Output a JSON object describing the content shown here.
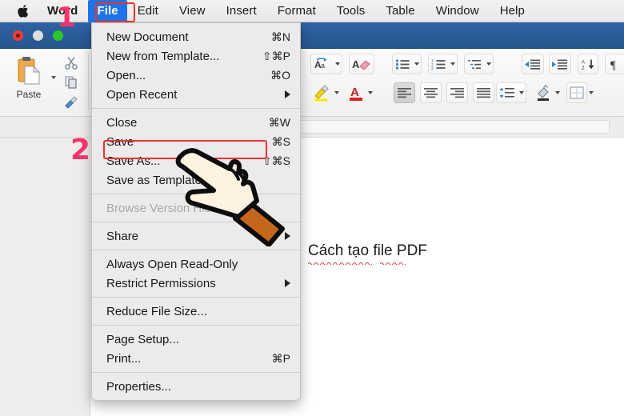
{
  "colors": {
    "menubar_bg": "#f1f0ee",
    "menu_highlight": "#1d74e8",
    "titlebar_blue": "#2b5d9a",
    "annotation_box": "#e8342c",
    "annotation_number": "#f2356f",
    "menu_bg": "#eceaea",
    "disabled_text": "#a9a8a7",
    "hand_fill": "#fdf3e0",
    "hand_cuff": "#c4661c"
  },
  "macbar": {
    "apple_icon": "apple-logo-icon",
    "items": [
      {
        "label": "Word",
        "bold": true,
        "active": false
      },
      {
        "label": "File",
        "bold": true,
        "active": true
      },
      {
        "label": "Edit",
        "bold": false,
        "active": false
      },
      {
        "label": "View",
        "bold": false,
        "active": false
      },
      {
        "label": "Insert",
        "bold": false,
        "active": false
      },
      {
        "label": "Format",
        "bold": false,
        "active": false
      },
      {
        "label": "Tools",
        "bold": false,
        "active": false
      },
      {
        "label": "Table",
        "bold": false,
        "active": false
      },
      {
        "label": "Window",
        "bold": false,
        "active": false
      },
      {
        "label": "Help",
        "bold": false,
        "active": false
      }
    ]
  },
  "window": {
    "traffic_lights": [
      "close-red",
      "minimize-gray",
      "zoom-green"
    ]
  },
  "ribbon": {
    "paste_label": "Paste",
    "paste_icon": "clipboard-paste-icon",
    "cut_icon": "scissors-cut-icon",
    "copy_icon": "copy-icon",
    "format_painter_icon": "format-painter-icon",
    "groups": [
      {
        "name": "font-effects",
        "items": [
          "change-case-icon",
          "clear-formatting-icon"
        ]
      },
      {
        "name": "highlight",
        "items": [
          "text-highlight-icon",
          "font-color-icon"
        ]
      },
      {
        "name": "lists",
        "items": [
          "bullet-list-icon",
          "numbered-list-icon",
          "multilevel-list-icon"
        ]
      },
      {
        "name": "indent",
        "items": [
          "decrease-indent-icon",
          "increase-indent-icon",
          "sort-icon",
          "paragraph-marks-icon"
        ]
      },
      {
        "name": "alignment",
        "items": [
          "align-left-icon",
          "align-center-icon",
          "align-right-icon",
          "align-justify-icon"
        ]
      },
      {
        "name": "spacing",
        "items": [
          "line-spacing-icon",
          "shading-icon",
          "borders-icon"
        ]
      }
    ]
  },
  "file_menu": {
    "groups": [
      {
        "items": [
          {
            "label": "New Document",
            "shortcut": "⌘N",
            "disabled": false,
            "submenu": false,
            "highlighted": false
          },
          {
            "label": "New from Template...",
            "shortcut": "⇧⌘P",
            "disabled": false,
            "submenu": false,
            "highlighted": false
          },
          {
            "label": "Open...",
            "shortcut": "⌘O",
            "disabled": false,
            "submenu": false,
            "highlighted": false
          },
          {
            "label": "Open Recent",
            "shortcut": "",
            "disabled": false,
            "submenu": true,
            "highlighted": false
          }
        ]
      },
      {
        "items": [
          {
            "label": "Close",
            "shortcut": "⌘W",
            "disabled": false,
            "submenu": false,
            "highlighted": false
          },
          {
            "label": "Save",
            "shortcut": "⌘S",
            "disabled": false,
            "submenu": false,
            "highlighted": false
          },
          {
            "label": "Save As...",
            "shortcut": "⇧⌘S",
            "disabled": false,
            "submenu": false,
            "highlighted": true
          },
          {
            "label": "Save as Template...",
            "shortcut": "",
            "disabled": false,
            "submenu": false,
            "highlighted": false
          }
        ]
      },
      {
        "items": [
          {
            "label": "Browse Version History...",
            "shortcut": "",
            "disabled": true,
            "submenu": false,
            "highlighted": false
          }
        ]
      },
      {
        "items": [
          {
            "label": "Share",
            "shortcut": "",
            "disabled": false,
            "submenu": true,
            "highlighted": false
          }
        ]
      },
      {
        "items": [
          {
            "label": "Always Open Read-Only",
            "shortcut": "",
            "disabled": false,
            "submenu": false,
            "highlighted": false
          },
          {
            "label": "Restrict Permissions",
            "shortcut": "",
            "disabled": false,
            "submenu": true,
            "highlighted": false
          }
        ]
      },
      {
        "items": [
          {
            "label": "Reduce File Size...",
            "shortcut": "",
            "disabled": false,
            "submenu": false,
            "highlighted": false
          }
        ]
      },
      {
        "items": [
          {
            "label": "Page Setup...",
            "shortcut": "",
            "disabled": false,
            "submenu": false,
            "highlighted": false
          },
          {
            "label": "Print...",
            "shortcut": "⌘P",
            "disabled": false,
            "submenu": false,
            "highlighted": false
          }
        ]
      },
      {
        "items": [
          {
            "label": "Properties...",
            "shortcut": "",
            "disabled": false,
            "submenu": false,
            "highlighted": false
          }
        ]
      }
    ]
  },
  "document": {
    "body_text": "Cách tạo file PDF"
  },
  "annotations": {
    "step_one": "1",
    "step_two": "2",
    "cursor_icon": "pointing-hand-cursor-icon",
    "box_one_target": "File",
    "box_two_target": "Save As..."
  }
}
